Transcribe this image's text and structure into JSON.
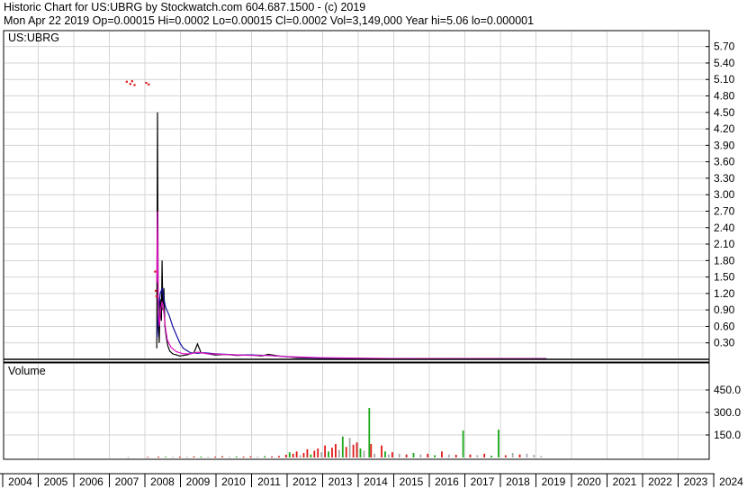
{
  "header": {
    "line1": "Historic Chart for US:UBRG by Stockwatch.com 604.687.1500 - (c) 2019",
    "line2": "Mon Apr 22 2019   Op=0.00015   Hi=0.0002   Lo=0.00015   Cl=0.0002   Vol=3,149,000   Year hi=5.06   lo=0.000001"
  },
  "chart_data": [
    {
      "type": "line",
      "title": "US:UBRG",
      "ylim": [
        0,
        6.0
      ],
      "y_ticks": [
        "5.70",
        "5.40",
        "5.10",
        "4.80",
        "4.50",
        "4.20",
        "3.90",
        "3.60",
        "3.30",
        "3.00",
        "2.70",
        "2.40",
        "2.10",
        "1.80",
        "1.50",
        "1.20",
        "0.90",
        "0.60",
        "0.30"
      ],
      "x_ticks": [
        "2004",
        "2005",
        "2006",
        "2007",
        "2008",
        "2009",
        "2010",
        "2011",
        "2012",
        "2013",
        "2014",
        "2015",
        "2016",
        "2017",
        "2018",
        "2019",
        "2020",
        "2021",
        "2022",
        "2023",
        "2024"
      ],
      "xlim": [
        2004.0,
        2024.1
      ],
      "series": [
        {
          "color": "#000000",
          "points": [
            [
              2008.35,
              0.2
            ],
            [
              2008.37,
              4.5
            ],
            [
              2008.39,
              0.8
            ],
            [
              2008.42,
              0.3
            ],
            [
              2008.45,
              1.1
            ],
            [
              2008.48,
              0.7
            ],
            [
              2008.5,
              1.8
            ],
            [
              2008.52,
              0.9
            ],
            [
              2008.55,
              1.3
            ],
            [
              2008.58,
              0.6
            ],
            [
              2008.62,
              0.4
            ],
            [
              2008.66,
              0.25
            ],
            [
              2008.72,
              0.15
            ],
            [
              2008.8,
              0.1
            ],
            [
              2008.9,
              0.08
            ],
            [
              2009.0,
              0.06
            ],
            [
              2009.2,
              0.08
            ],
            [
              2009.4,
              0.12
            ],
            [
              2009.5,
              0.28
            ],
            [
              2009.6,
              0.12
            ],
            [
              2009.8,
              0.1
            ],
            [
              2010.0,
              0.08
            ],
            [
              2010.3,
              0.09
            ],
            [
              2010.6,
              0.07
            ],
            [
              2011.0,
              0.08
            ],
            [
              2011.3,
              0.06
            ],
            [
              2011.5,
              0.09
            ],
            [
              2011.8,
              0.06
            ],
            [
              2012.0,
              0.05
            ],
            [
              2012.3,
              0.03
            ],
            [
              2013.0,
              0.02
            ],
            [
              2015.0,
              0.01
            ],
            [
              2019.35,
              0.01
            ]
          ]
        },
        {
          "color": "#1010a0",
          "points": [
            [
              2008.36,
              0.4
            ],
            [
              2008.4,
              0.9
            ],
            [
              2008.45,
              1.2
            ],
            [
              2008.5,
              1.3
            ],
            [
              2008.55,
              1.1
            ],
            [
              2008.6,
              0.95
            ],
            [
              2008.7,
              0.8
            ],
            [
              2008.8,
              0.6
            ],
            [
              2008.9,
              0.45
            ],
            [
              2009.0,
              0.3
            ],
            [
              2009.1,
              0.2
            ],
            [
              2009.3,
              0.12
            ],
            [
              2009.5,
              0.11
            ],
            [
              2009.7,
              0.12
            ],
            [
              2010.0,
              0.1
            ],
            [
              2010.3,
              0.09
            ],
            [
              2010.6,
              0.08
            ],
            [
              2011.0,
              0.08
            ],
            [
              2011.5,
              0.07
            ],
            [
              2012.0,
              0.05
            ],
            [
              2012.3,
              0.04
            ],
            [
              2013.0,
              0.02
            ],
            [
              2016.0,
              0.01
            ],
            [
              2019.35,
              0.01
            ]
          ]
        },
        {
          "color": "#e010c0",
          "points": [
            [
              2008.35,
              1.4
            ],
            [
              2008.37,
              2.7
            ],
            [
              2008.39,
              1.0
            ],
            [
              2008.42,
              0.6
            ],
            [
              2008.46,
              0.9
            ],
            [
              2008.5,
              1.05
            ],
            [
              2008.55,
              0.85
            ],
            [
              2008.6,
              0.55
            ],
            [
              2008.65,
              0.35
            ],
            [
              2008.75,
              0.22
            ],
            [
              2008.9,
              0.14
            ],
            [
              2009.1,
              0.1
            ],
            [
              2009.3,
              0.1
            ],
            [
              2009.5,
              0.13
            ],
            [
              2009.8,
              0.1
            ],
            [
              2010.2,
              0.09
            ],
            [
              2010.6,
              0.08
            ],
            [
              2011.0,
              0.07
            ],
            [
              2011.5,
              0.07
            ],
            [
              2012.0,
              0.05
            ],
            [
              2013.0,
              0.03
            ],
            [
              2015.0,
              0.015
            ],
            [
              2019.35,
              0.012
            ]
          ]
        }
      ],
      "dots": [
        [
          2007.5,
          5.06
        ],
        [
          2007.6,
          5.02
        ],
        [
          2007.65,
          5.07
        ],
        [
          2007.72,
          5.0
        ],
        [
          2008.05,
          5.04
        ],
        [
          2008.12,
          5.01
        ],
        [
          2008.3,
          1.6
        ],
        [
          2008.32,
          1.25
        ],
        [
          2008.34,
          1.15
        ]
      ]
    },
    {
      "type": "bar",
      "title": "Volume",
      "ylim": [
        0,
        520
      ],
      "y_ticks": [
        "450.0",
        "300.0",
        "150.0"
      ],
      "x_ticks": [
        "2004",
        "2005",
        "2006",
        "2007",
        "2008",
        "2009",
        "2010",
        "2011",
        "2012",
        "2013",
        "2014",
        "2015",
        "2016",
        "2017",
        "2018",
        "2019",
        "2020",
        "2021",
        "2022",
        "2023",
        "2024"
      ],
      "colors": {
        "up": "#18a818",
        "down": "#e01818",
        "flat": "#a8a8a8"
      },
      "bars": [
        [
          2007.55,
          3,
          "flat"
        ],
        [
          2008.1,
          4,
          "down"
        ],
        [
          2008.4,
          6,
          "down"
        ],
        [
          2008.6,
          5,
          "up"
        ],
        [
          2008.8,
          4,
          "flat"
        ],
        [
          2009.0,
          6,
          "down"
        ],
        [
          2009.2,
          5,
          "flat"
        ],
        [
          2009.4,
          7,
          "down"
        ],
        [
          2009.6,
          6,
          "up"
        ],
        [
          2009.8,
          5,
          "flat"
        ],
        [
          2010.0,
          6,
          "down"
        ],
        [
          2010.2,
          8,
          "down"
        ],
        [
          2010.4,
          5,
          "flat"
        ],
        [
          2010.6,
          7,
          "up"
        ],
        [
          2010.8,
          6,
          "down"
        ],
        [
          2011.0,
          8,
          "down"
        ],
        [
          2011.2,
          6,
          "flat"
        ],
        [
          2011.4,
          9,
          "up"
        ],
        [
          2011.6,
          7,
          "down"
        ],
        [
          2011.8,
          10,
          "down"
        ],
        [
          2012.0,
          18,
          "down"
        ],
        [
          2012.1,
          35,
          "up"
        ],
        [
          2012.2,
          25,
          "down"
        ],
        [
          2012.3,
          40,
          "down"
        ],
        [
          2012.4,
          15,
          "flat"
        ],
        [
          2012.5,
          30,
          "down"
        ],
        [
          2012.6,
          55,
          "down"
        ],
        [
          2012.7,
          20,
          "up"
        ],
        [
          2012.8,
          45,
          "down"
        ],
        [
          2012.9,
          60,
          "down"
        ],
        [
          2013.0,
          35,
          "flat"
        ],
        [
          2013.1,
          80,
          "down"
        ],
        [
          2013.2,
          40,
          "up"
        ],
        [
          2013.3,
          65,
          "down"
        ],
        [
          2013.4,
          90,
          "down"
        ],
        [
          2013.5,
          50,
          "flat"
        ],
        [
          2013.6,
          140,
          "up"
        ],
        [
          2013.7,
          70,
          "down"
        ],
        [
          2013.8,
          130,
          "flat"
        ],
        [
          2013.9,
          85,
          "down"
        ],
        [
          2014.0,
          100,
          "down"
        ],
        [
          2014.1,
          60,
          "up"
        ],
        [
          2014.2,
          45,
          "flat"
        ],
        [
          2014.35,
          330,
          "up"
        ],
        [
          2014.4,
          90,
          "down"
        ],
        [
          2014.5,
          25,
          "flat"
        ],
        [
          2014.7,
          80,
          "down"
        ],
        [
          2014.8,
          40,
          "up"
        ],
        [
          2014.9,
          20,
          "flat"
        ],
        [
          2015.0,
          35,
          "down"
        ],
        [
          2015.2,
          25,
          "flat"
        ],
        [
          2015.4,
          20,
          "down"
        ],
        [
          2015.6,
          30,
          "up"
        ],
        [
          2015.8,
          20,
          "flat"
        ],
        [
          2016.0,
          25,
          "down"
        ],
        [
          2016.2,
          15,
          "up"
        ],
        [
          2016.4,
          40,
          "down"
        ],
        [
          2016.6,
          20,
          "flat"
        ],
        [
          2016.8,
          18,
          "down"
        ],
        [
          2017.0,
          180,
          "up"
        ],
        [
          2017.2,
          20,
          "down"
        ],
        [
          2017.4,
          15,
          "flat"
        ],
        [
          2017.6,
          25,
          "down"
        ],
        [
          2017.8,
          12,
          "up"
        ],
        [
          2018.0,
          185,
          "up"
        ],
        [
          2018.2,
          15,
          "down"
        ],
        [
          2018.4,
          30,
          "flat"
        ],
        [
          2018.6,
          20,
          "down"
        ],
        [
          2018.8,
          25,
          "flat"
        ],
        [
          2019.0,
          18,
          "flat"
        ],
        [
          2019.2,
          10,
          "flat"
        ]
      ]
    }
  ]
}
